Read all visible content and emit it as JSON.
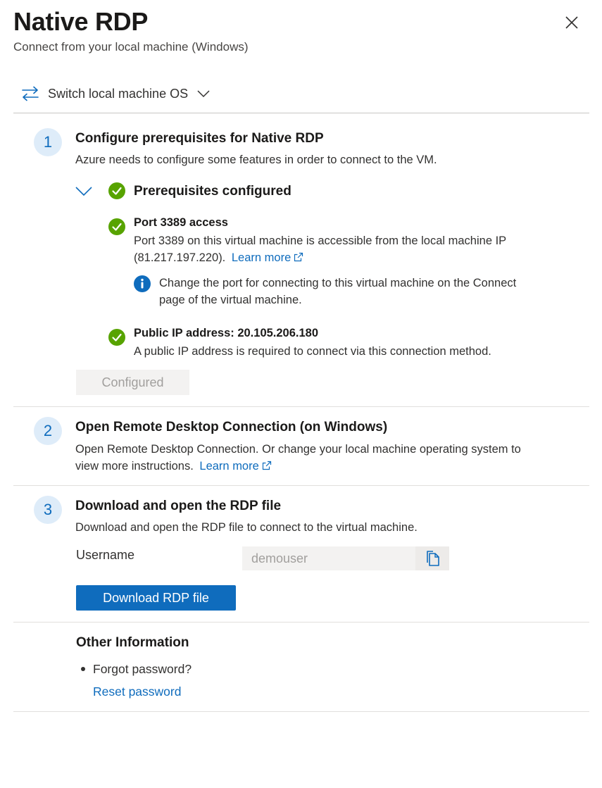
{
  "header": {
    "title": "Native RDP",
    "subtitle": "Connect from your local machine (Windows)",
    "close_icon": "close-icon"
  },
  "switch_os": {
    "label": "Switch local machine OS",
    "icon": "switch-arrows-icon"
  },
  "step1": {
    "number": "1",
    "title": "Configure prerequisites for Native RDP",
    "description": "Azure needs to configure some features in order to connect to the VM.",
    "status": "Prerequisites configured",
    "port": {
      "title": "Port 3389 access",
      "line1": "Port 3389 on this virtual machine is accessible from the local machine IP",
      "line2": "(81.217.197.220).",
      "link": "Learn more",
      "info_line1": "Change the port for connecting to this virtual machine on the Connect",
      "info_line2": "page of the virtual machine."
    },
    "public_ip": {
      "title": "Public IP address: 20.105.206.180",
      "description": "A public IP address is required to connect via this connection method."
    },
    "button": "Configured"
  },
  "step2": {
    "number": "2",
    "title": "Open Remote Desktop Connection (on Windows)",
    "line1": "Open Remote Desktop Connection. Or change your local machine operating system to",
    "line2": "view more instructions.",
    "link": "Learn more"
  },
  "step3": {
    "number": "3",
    "title": "Download and open the RDP file",
    "description": "Download and open the RDP file to connect to the virtual machine.",
    "username_label": "Username",
    "username_value": "demouser",
    "download_button": "Download RDP file"
  },
  "other": {
    "title": "Other Information",
    "bullet": "Forgot password?",
    "link": "Reset password"
  },
  "colors": {
    "accent": "#0f6cbd",
    "success": "#57a300",
    "step_circle_bg": "#deecf9"
  }
}
